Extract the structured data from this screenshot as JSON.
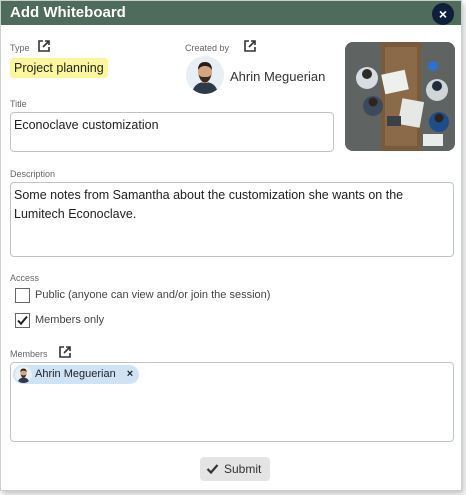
{
  "dialog": {
    "title": "Add Whiteboard",
    "close_glyph": "×"
  },
  "type": {
    "label": "Type",
    "value": "Project planning",
    "highlight_color": "#f9f79a"
  },
  "created_by": {
    "label": "Created by",
    "name": "Ahrin Meguerian"
  },
  "title_field": {
    "label": "Title",
    "value": "Econoclave customization"
  },
  "description_field": {
    "label": "Description",
    "value": "Some notes from Samantha about the customization she wants on the Lumitech Econoclave."
  },
  "access": {
    "label": "Access",
    "options": [
      {
        "label": "Public (anyone can view and/or join the session)",
        "checked": false
      },
      {
        "label": "Members only",
        "checked": true
      }
    ]
  },
  "members": {
    "label": "Members",
    "items": [
      {
        "name": "Ahrin Meguerian",
        "remove_glyph": "×"
      }
    ],
    "chip_color": "#cfe3f7"
  },
  "submit": {
    "label": "Submit"
  },
  "colors": {
    "titlebar": "#4e6b5c",
    "close_button": "#0f1f3a"
  },
  "icons": {
    "external_link": "external-link-icon",
    "close": "close-icon",
    "check": "check-icon"
  }
}
